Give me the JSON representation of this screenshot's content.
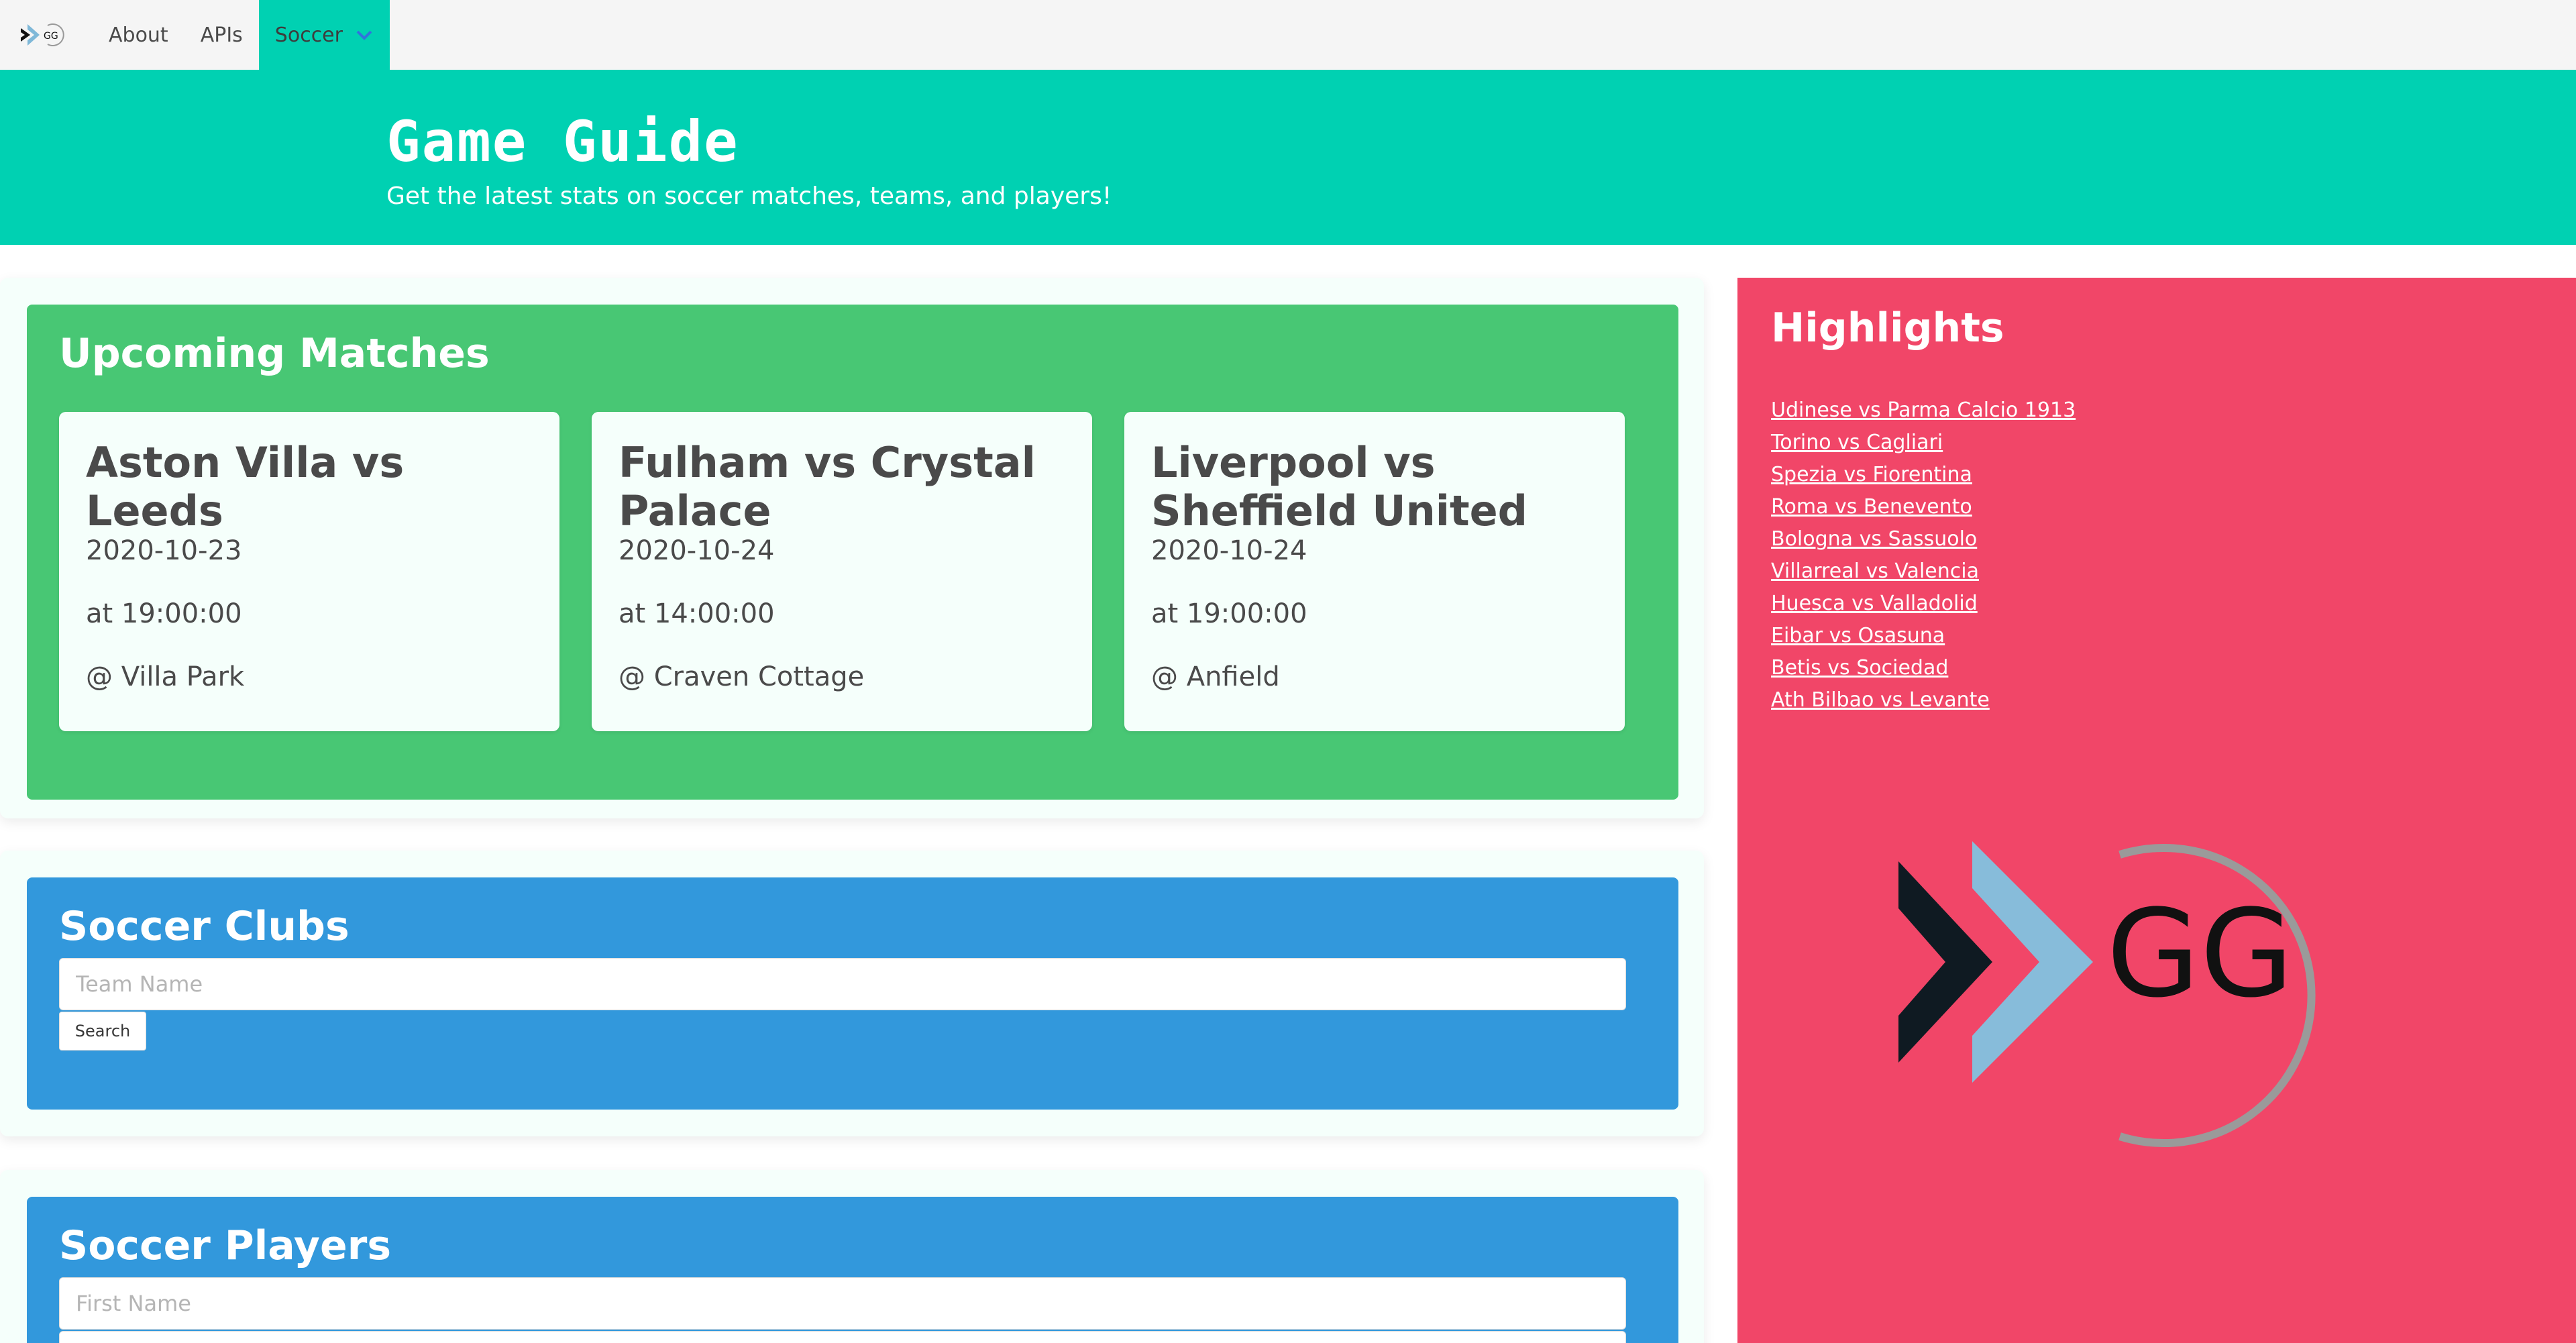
{
  "nav": {
    "logo_text": "GG",
    "items": [
      {
        "label": "About"
      },
      {
        "label": "APIs"
      },
      {
        "label": "Soccer"
      }
    ]
  },
  "hero": {
    "title": "Game Guide",
    "subtitle": "Get the latest stats on soccer matches, teams, and players!"
  },
  "upcoming": {
    "title": "Upcoming Matches",
    "matches": [
      {
        "title": "Aston Villa vs Leeds",
        "date": "2020-10-23",
        "time": "at 19:00:00",
        "venue": "@ Villa Park"
      },
      {
        "title": "Fulham vs Crystal Palace",
        "date": "2020-10-24",
        "time": "at 14:00:00",
        "venue": "@ Craven Cottage"
      },
      {
        "title": "Liverpool vs Sheffield United",
        "date": "2020-10-24",
        "time": "at 19:00:00",
        "venue": "@ Anfield"
      }
    ]
  },
  "clubs": {
    "title": "Soccer Clubs",
    "placeholder": "Team Name",
    "button": "Search"
  },
  "players": {
    "title": "Soccer Players",
    "placeholder": "First Name"
  },
  "highlights": {
    "title": "Highlights",
    "items": [
      "Udinese vs Parma Calcio 1913",
      "Torino vs Cagliari",
      "Spezia vs Fiorentina",
      "Roma vs Benevento",
      "Bologna vs Sassuolo",
      "Villarreal vs Valencia",
      "Huesca vs Valladolid",
      "Eibar vs Osasuna",
      "Betis vs Sociedad",
      "Ath Bilbao vs Levante"
    ],
    "logo_text": "GG"
  },
  "colors": {
    "primary": "#00d1b2",
    "success": "#48c774",
    "info": "#3298dc",
    "danger": "#f14668"
  }
}
